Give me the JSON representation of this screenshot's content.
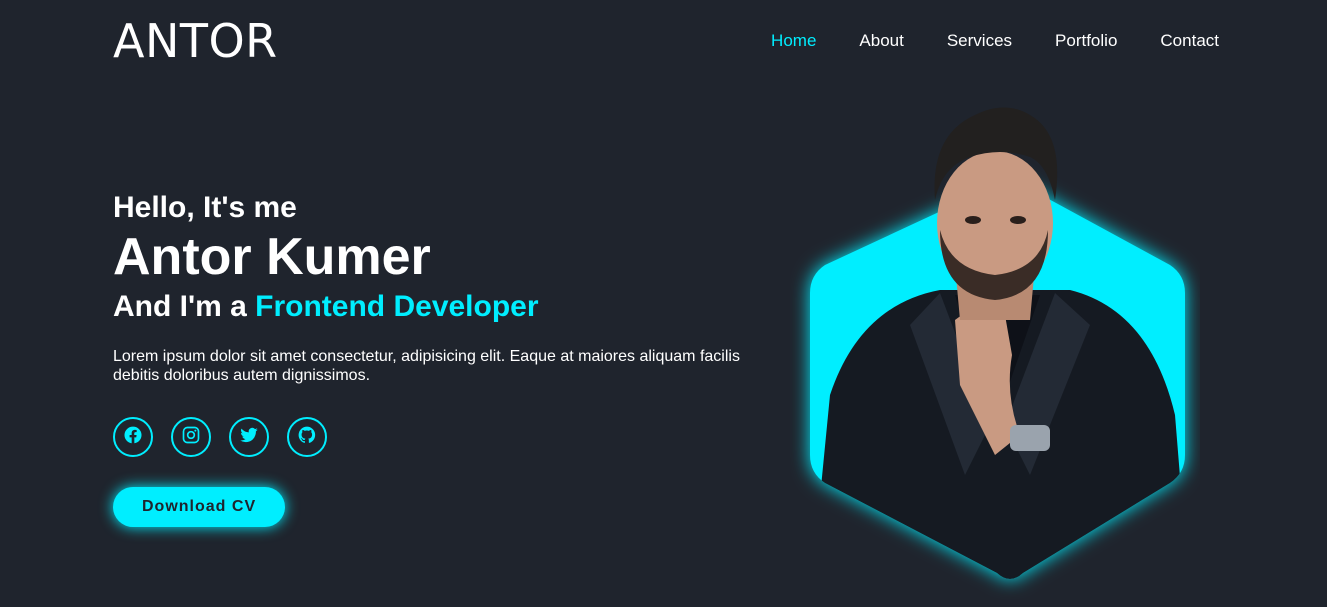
{
  "header": {
    "logo": "ANTOR",
    "nav": [
      {
        "label": "Home",
        "active": true
      },
      {
        "label": "About",
        "active": false
      },
      {
        "label": "Services",
        "active": false
      },
      {
        "label": "Portfolio",
        "active": false
      },
      {
        "label": "Contact",
        "active": false
      }
    ]
  },
  "hero": {
    "greeting": "Hello, It's me",
    "name": "Antor Kumer",
    "role_prefix": "And I'm a ",
    "role_accent": "Frontend Developer",
    "description": "Lorem ipsum dolor sit amet consectetur, adipisicing elit. Eaque at maiores aliquam facilis debitis doloribus autem dignissimos.",
    "socials": [
      {
        "icon": "facebook-icon"
      },
      {
        "icon": "instagram-icon"
      },
      {
        "icon": "twitter-icon"
      },
      {
        "icon": "github-icon"
      }
    ],
    "cta_label": "Download CV"
  },
  "colors": {
    "background": "#1f242d",
    "accent": "#00eeff",
    "text": "#ffffff"
  }
}
